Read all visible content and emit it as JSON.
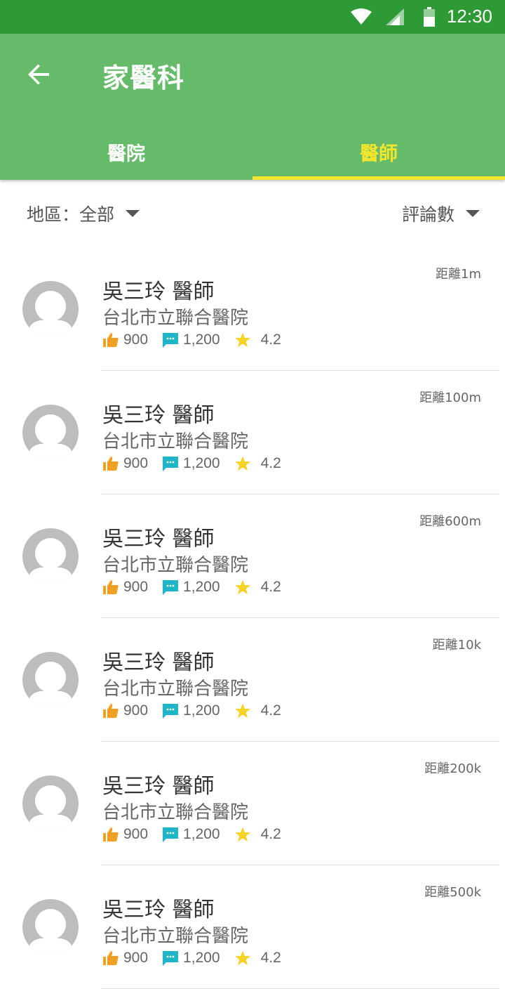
{
  "status_bar": {
    "time": "12:30"
  },
  "header": {
    "title": "家醫科"
  },
  "tabs": [
    {
      "label": "醫院",
      "active": false
    },
    {
      "label": "醫師",
      "active": true
    }
  ],
  "filters": {
    "region": "地區：全部",
    "sort": "評論數"
  },
  "colors": {
    "status_bar": "#2e9a36",
    "app_bar": "#65bb69",
    "active_tab": "#f4e62b",
    "like_icon": "#f2a024",
    "comment_icon": "#1fb6c7",
    "star_icon": "#f7d22a",
    "avatar": "#bdbdbd"
  },
  "doctors": [
    {
      "name": "吳三玲 醫師",
      "hospital": "台北市立聯合醫院",
      "likes": "900",
      "comments": "1,200",
      "rating": "4.2",
      "distance": "距離1m"
    },
    {
      "name": "吳三玲 醫師",
      "hospital": "台北市立聯合醫院",
      "likes": "900",
      "comments": "1,200",
      "rating": "4.2",
      "distance": "距離100m"
    },
    {
      "name": "吳三玲 醫師",
      "hospital": "台北市立聯合醫院",
      "likes": "900",
      "comments": "1,200",
      "rating": "4.2",
      "distance": "距離600m"
    },
    {
      "name": "吳三玲 醫師",
      "hospital": "台北市立聯合醫院",
      "likes": "900",
      "comments": "1,200",
      "rating": "4.2",
      "distance": "距離10k"
    },
    {
      "name": "吳三玲 醫師",
      "hospital": "台北市立聯合醫院",
      "likes": "900",
      "comments": "1,200",
      "rating": "4.2",
      "distance": "距離200k"
    },
    {
      "name": "吳三玲 醫師",
      "hospital": "台北市立聯合醫院",
      "likes": "900",
      "comments": "1,200",
      "rating": "4.2",
      "distance": "距離500k"
    }
  ]
}
